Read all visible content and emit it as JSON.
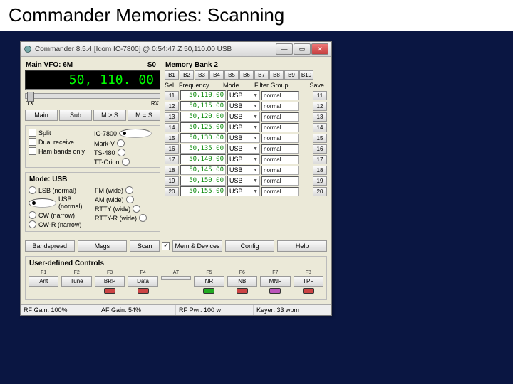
{
  "slide": {
    "title": "Commander Memories: Scanning"
  },
  "window": {
    "title": "Commander 8.5.4 [Icom IC-7800] @ 0:54:47 Z  50,110.00 USB"
  },
  "vfo": {
    "heading": "Main VFO: 6M",
    "s0": "S0",
    "freq": "50, 110. 00",
    "slider_left": "TX",
    "slider_right": "RX"
  },
  "vfo_buttons": {
    "main": "Main",
    "sub": "Sub",
    "swap": "M > S",
    "copy": "M = S"
  },
  "rx_opts": [
    "Split",
    "Dual receive",
    "Ham bands only"
  ],
  "rigs": [
    {
      "name": "IC-7800",
      "sel": true
    },
    {
      "name": "Mark-V",
      "sel": false
    },
    {
      "name": "TS-480",
      "sel": false
    },
    {
      "name": "TT-Orion",
      "sel": false
    }
  ],
  "mode": {
    "heading": "Mode: USB",
    "left": [
      {
        "n": "LSB (normal)"
      },
      {
        "n": "USB (normal)",
        "sel": true
      },
      {
        "n": "CW (narrow)"
      },
      {
        "n": "CW-R (narrow)"
      }
    ],
    "right": [
      {
        "n": "FM (wide)"
      },
      {
        "n": "AM (wide)"
      },
      {
        "n": "RTTY (wide)"
      },
      {
        "n": "RTTY-R (wide)"
      }
    ]
  },
  "bank": {
    "heading": "Memory Bank 2",
    "buttons": [
      "B1",
      "B2",
      "B3",
      "B4",
      "B5",
      "B6",
      "B7",
      "B8",
      "B9",
      "B10"
    ],
    "cols": {
      "sel": "Sel",
      "freq": "Frequency",
      "mode": "Mode",
      "flt": "Filter Group",
      "save": "Save"
    },
    "rows": [
      {
        "n": "11",
        "f": "50,110.00",
        "m": "USB",
        "g": "normal",
        "s": "11"
      },
      {
        "n": "12",
        "f": "50,115.00",
        "m": "USB",
        "g": "normal",
        "s": "12"
      },
      {
        "n": "13",
        "f": "50,120.00",
        "m": "USB",
        "g": "normal",
        "s": "13"
      },
      {
        "n": "14",
        "f": "50,125.00",
        "m": "USB",
        "g": "normal",
        "s": "14"
      },
      {
        "n": "15",
        "f": "50,130.00",
        "m": "USB",
        "g": "normal",
        "s": "15"
      },
      {
        "n": "16",
        "f": "50,135.00",
        "m": "USB",
        "g": "normal",
        "s": "16"
      },
      {
        "n": "17",
        "f": "50,140.00",
        "m": "USB",
        "g": "normal",
        "s": "17"
      },
      {
        "n": "18",
        "f": "50,145.00",
        "m": "USB",
        "g": "normal",
        "s": "18"
      },
      {
        "n": "19",
        "f": "50,150.00",
        "m": "USB",
        "g": "normal",
        "s": "19"
      },
      {
        "n": "20",
        "f": "50,155.00",
        "m": "USB",
        "g": "normal",
        "s": "20"
      }
    ]
  },
  "actions": {
    "bandspread": "Bandspread",
    "msgs": "Msgs",
    "scan": "Scan",
    "mem": "Mem & Devices",
    "config": "Config",
    "help": "Help"
  },
  "udc": {
    "heading": "User-defined Controls",
    "cells": [
      {
        "l": "F1",
        "n": "Ant",
        "led": null
      },
      {
        "l": "F2",
        "n": "Tune",
        "led": null
      },
      {
        "l": "F3",
        "n": "BRP",
        "led": "#c44"
      },
      {
        "l": "F4",
        "n": "Data",
        "led": "#c44"
      },
      {
        "l": "AT",
        "n": "",
        "led": null
      },
      {
        "l": "F5",
        "n": "NR",
        "led": "#2a2"
      },
      {
        "l": "F6",
        "n": "NB",
        "led": "#c44"
      },
      {
        "l": "F7",
        "n": "MNF",
        "led": "#b5b"
      },
      {
        "l": "F8",
        "n": "TPF",
        "led": "#c44"
      }
    ]
  },
  "status": {
    "rf": "RF Gain: 100%",
    "af": "AF Gain: 54%",
    "pw": "RF Pwr: 100 w",
    "ky": "Keyer: 33 wpm"
  }
}
